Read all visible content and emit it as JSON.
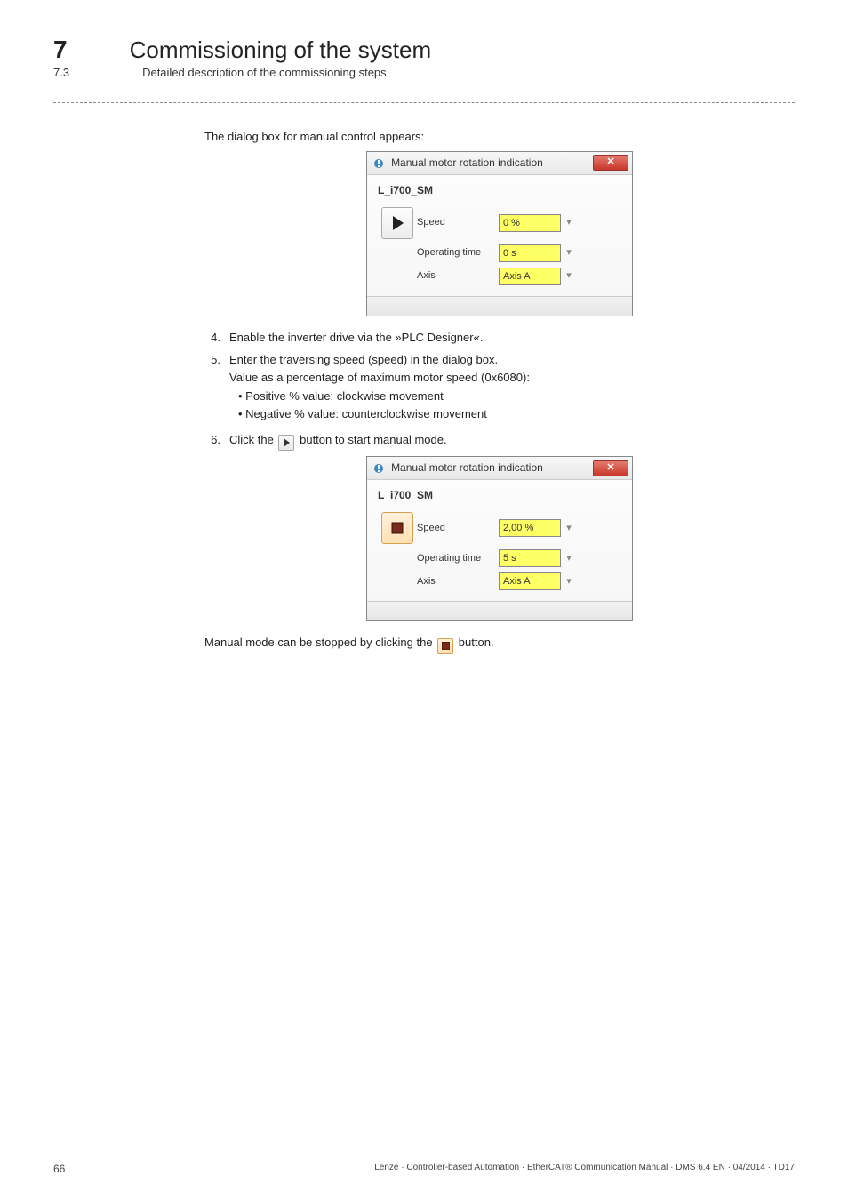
{
  "header": {
    "chapter_num": "7",
    "chapter_title": "Commissioning of the system",
    "section_num": "7.3",
    "section_title": "Detailed description of the commissioning steps"
  },
  "intro": "The dialog box for manual control appears:",
  "dialog1": {
    "title": "Manual motor rotation indication",
    "device": "L_i700_SM",
    "speed_label": "Speed",
    "speed_value": "0 %",
    "optime_label": "Operating time",
    "optime_value": "0 s",
    "axis_label": "Axis",
    "axis_value": "Axis A",
    "mode": "play"
  },
  "steps": {
    "s4": {
      "n": "4.",
      "t": "Enable the inverter drive via the »PLC Designer«."
    },
    "s5": {
      "n": "5.",
      "t": "Enter the traversing speed (speed) in the dialog box.",
      "sub": "Value as a percentage of maximum motor speed (0x6080):",
      "b1": "Positive % value: clockwise movement",
      "b2": "Negative % value: counterclockwise movement"
    },
    "s6": {
      "n": "6.",
      "pre": "Click the",
      "post": " button to start manual mode."
    }
  },
  "dialog2": {
    "title": "Manual motor rotation indication",
    "device": "L_i700_SM",
    "speed_label": "Speed",
    "speed_value": "2,00 %",
    "optime_label": "Operating time",
    "optime_value": "5 s",
    "axis_label": "Axis",
    "axis_value": "Axis A",
    "mode": "stop"
  },
  "outro_pre": "Manual mode can be stopped by clicking the",
  "outro_post": " button.",
  "footer": {
    "page": "66",
    "line": "Lenze · Controller-based Automation · EtherCAT® Communication Manual · DMS 6.4 EN · 04/2014 · TD17"
  }
}
